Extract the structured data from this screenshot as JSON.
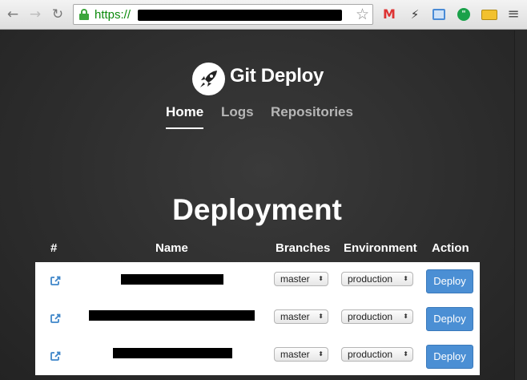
{
  "browser": {
    "url_scheme": "https://",
    "icons": [
      "back-icon",
      "forward-icon",
      "reload-icon",
      "lock-icon",
      "star-icon",
      "gmail-icon",
      "bolt-icon",
      "cast-icon",
      "hangouts-icon",
      "ruler-icon",
      "menu-icon"
    ]
  },
  "brand": {
    "name": "Git Deploy",
    "logo": "rocket-icon"
  },
  "nav": {
    "home": "Home",
    "logs": "Logs",
    "repositories": "Repositories",
    "active": "Home"
  },
  "main": {
    "title": "Deployment",
    "columns": {
      "num": "#",
      "name": "Name",
      "branches": "Branches",
      "environment": "Environment",
      "action": "Action"
    },
    "rows": [
      {
        "branch": "master",
        "environment": "production",
        "action": "Deploy"
      },
      {
        "branch": "master",
        "environment": "production",
        "action": "Deploy"
      },
      {
        "branch": "master",
        "environment": "production",
        "action": "Deploy"
      }
    ]
  },
  "colors": {
    "accent": "#4b8fd4",
    "background": "#2b2b2b",
    "secure": "#3ba53b"
  }
}
